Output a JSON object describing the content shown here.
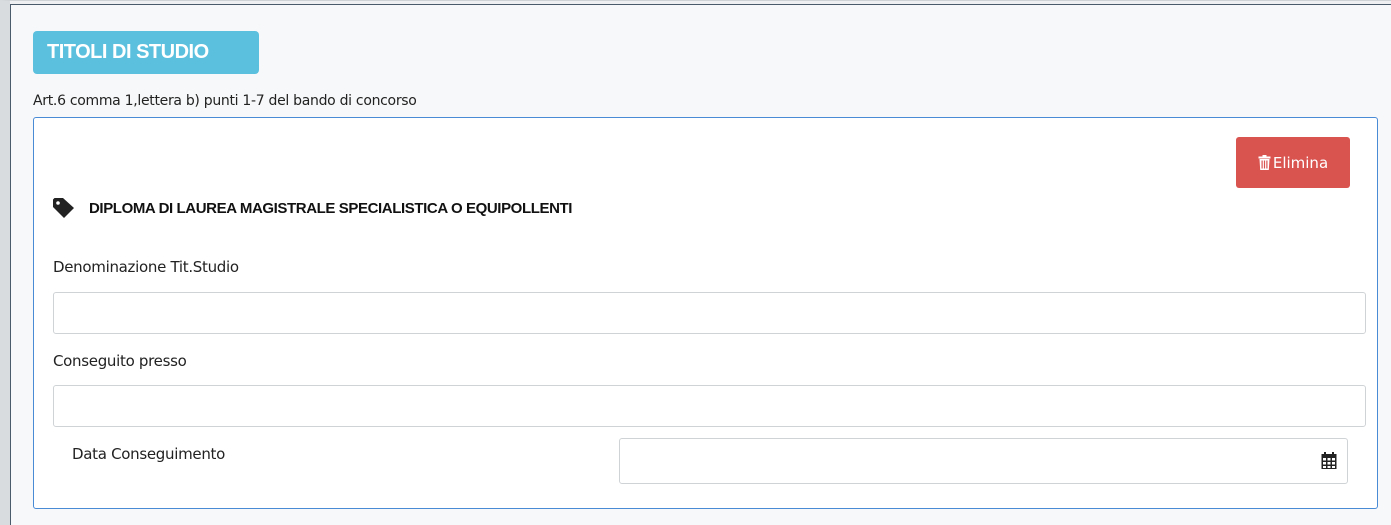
{
  "section": {
    "title": "TITOLI DI STUDIO",
    "subtitle": "Art.6 comma 1,lettera b) punti 1-7 del bando di concorso"
  },
  "card": {
    "delete_label": "Elimina",
    "delete_icon": "trash-icon",
    "diploma_icon": "tag-icon",
    "diploma_title": "DIPLOMA DI LAUREA MAGISTRALE SPECIALISTICA O EQUIPOLLENTI",
    "fields": {
      "denominazione_label": "Denominazione Tit.Studio",
      "denominazione_value": "",
      "conseguito_label": "Conseguito presso",
      "conseguito_value": "",
      "data_label": "Data Conseguimento",
      "data_value": "",
      "calendar_icon": "calendar-icon"
    }
  },
  "colors": {
    "badge": "#5bc0de",
    "danger": "#d9534f",
    "card_border": "#4a8bd6"
  }
}
